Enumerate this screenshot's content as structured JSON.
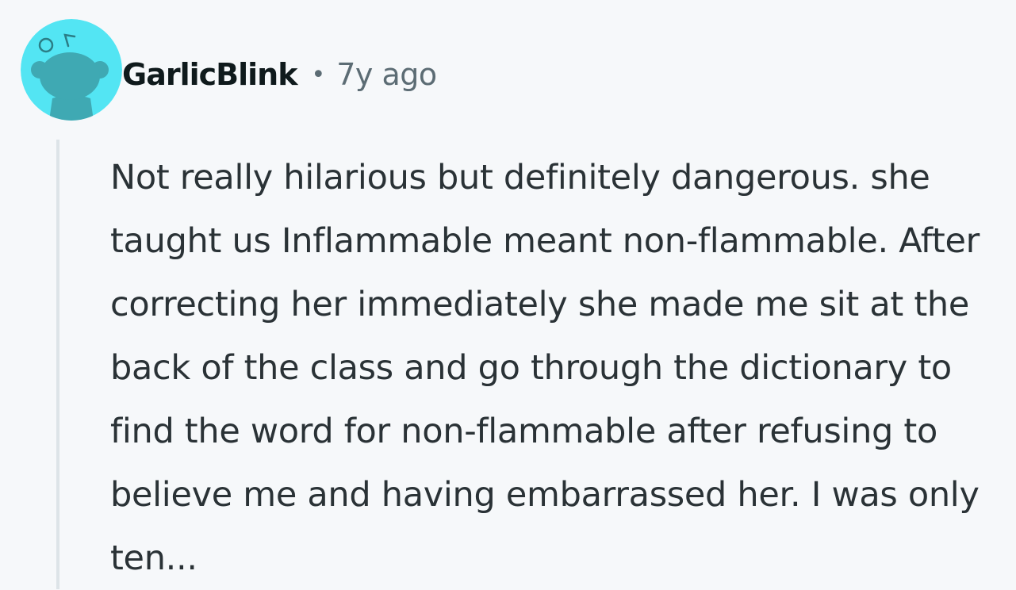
{
  "comment": {
    "avatar": {
      "icon": "snoo-avatar-icon",
      "background_color": "#53e5f3",
      "figure_color": "#3fa9b3"
    },
    "author": "GarlicBlink",
    "separator": "•",
    "timestamp": "7y ago",
    "body": "Not really hilarious but definitely dangerous. she taught us Inflammable meant non-flammable. After correcting her immediately she made me sit at the back of the class and go through the dictionary to find the word for non-flammable after refusing to believe me and having embarrassed her. I was only ten..."
  }
}
